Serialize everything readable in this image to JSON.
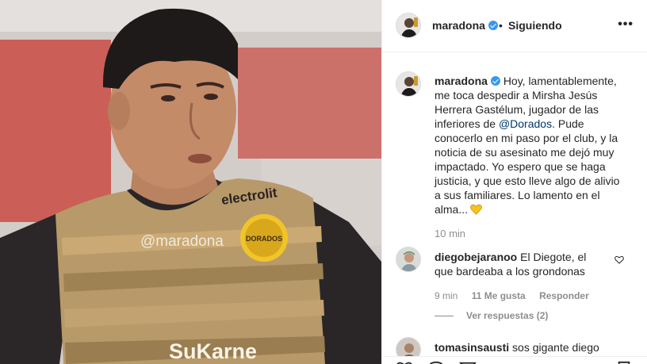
{
  "photo": {
    "watermark": "@maradona",
    "sponsor": "SuKarne",
    "shirt_text": "electrolit",
    "badge_text": "DORADOS"
  },
  "header": {
    "username": "maradona",
    "separator": "•",
    "follow_status": "Siguiendo",
    "more": "•••"
  },
  "caption": {
    "username": "maradona",
    "text_before_mention": "Hoy, lamentablemente, me toca despedir a Mirsha Jesús Herrera Gastélum, jugador de las inferiores de",
    "mention": "@Dorados",
    "text_after_mention": ". Pude conocerlo en mi paso por el club, y la noticia de su asesinato me dejó muy impactado. Yo espero que se haga justicia, y que esto lleve algo de alivio a sus familiares. Lo lamento en el alma...",
    "time": "10 min"
  },
  "comments": [
    {
      "username": "diegobejaranoo",
      "text": "El Diegote, el que bardeaba a los grondonas",
      "time": "9 min",
      "likes": "11 Me gusta",
      "reply": "Responder",
      "view_replies": "Ver respuestas (2)"
    },
    {
      "username": "tomasinsausti",
      "text": "sos gigante diego"
    }
  ],
  "colors": {
    "verified": "#3897f0",
    "mention": "#00376b",
    "emoji_heart": "#f7c21b",
    "muted": "#8e8e8e"
  }
}
